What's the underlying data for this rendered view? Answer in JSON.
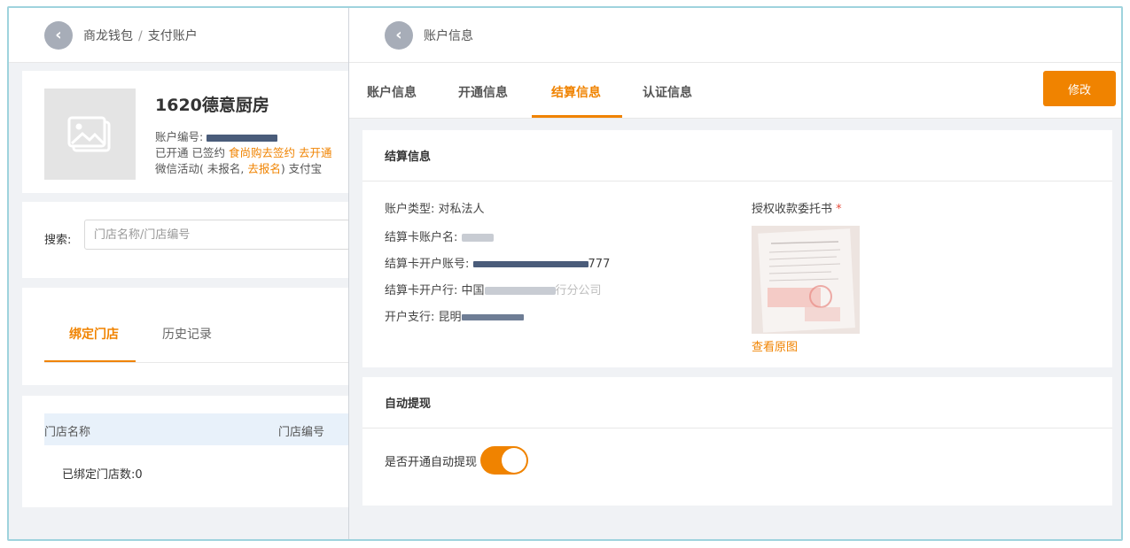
{
  "left": {
    "breadcrumb": {
      "root": "商龙钱包",
      "sep": "/",
      "current": "支付账户"
    },
    "profile": {
      "shop_name": "1620德意厨房",
      "account_no_label": "账户编号:",
      "status_prefix": "已开通 已签约",
      "shishanggou_link": "食尚购去签约",
      "go_open_link": "去开通",
      "wechat_prefix": "微信活动( 未报名,",
      "go_register_link": "去报名",
      "wechat_suffix": ") 支付宝"
    },
    "search": {
      "label": "搜索:",
      "placeholder": "门店名称/门店编号"
    },
    "tabs": [
      {
        "label": "绑定门店"
      },
      {
        "label": "历史记录"
      }
    ],
    "table": {
      "columns": [
        "门店名称",
        "门店编号"
      ],
      "bound_count": "已绑定门店数:0"
    }
  },
  "drawer": {
    "title": "账户信息",
    "tabs": [
      {
        "label": "账户信息"
      },
      {
        "label": "开通信息"
      },
      {
        "label": "结算信息"
      },
      {
        "label": "认证信息"
      }
    ],
    "edit_label": "修改",
    "settlement": {
      "heading": "结算信息",
      "account_type": "账户类型: 对私法人",
      "card_name_label": "结算卡账户名:",
      "card_no_label": "结算卡开户账号:",
      "card_no_tail": "777",
      "bank_label": "结算卡开户行:",
      "bank_head": "中国",
      "bank_tail": "行分公司",
      "branch_label": "开户支行:",
      "branch_head": "昆明",
      "auth_label": "授权收款委托书",
      "required_mark": "*",
      "view_original": "查看原图"
    },
    "auto_withdraw": {
      "heading": "自动提现",
      "toggle_label": "是否开通自动提现",
      "enabled": true
    }
  },
  "colors": {
    "accent": "#f08300",
    "frame": "#9fd3dd",
    "bg": "#f0f2f5"
  }
}
